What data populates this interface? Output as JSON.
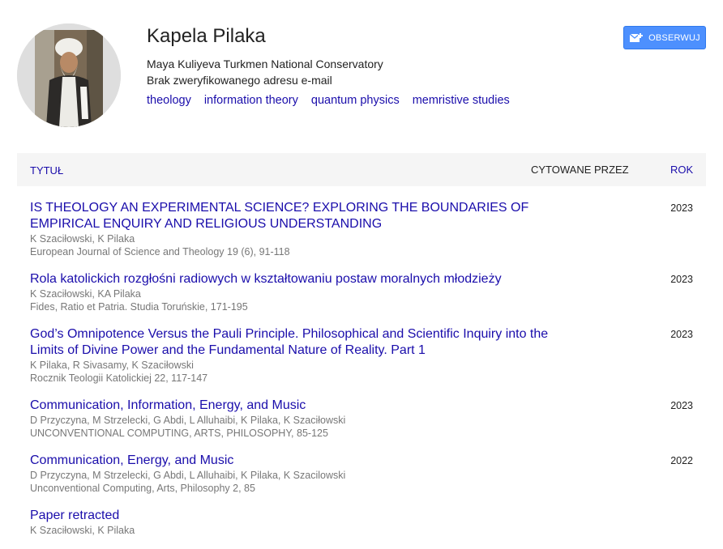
{
  "profile": {
    "name": "Kapela Pilaka",
    "affiliation": "Maya Kuliyeva Turkmen National Conservatory",
    "email_status": "Brak zweryfikowanego adresu e-mail",
    "interests": [
      "theology",
      "information theory",
      "quantum physics",
      "memristive studies"
    ],
    "follow_label": "OBSERWUJ"
  },
  "table": {
    "col_title": "TYTUŁ",
    "col_cited": "CYTOWANE PRZEZ",
    "col_year": "ROK"
  },
  "articles": [
    {
      "title": "IS THEOLOGY AN EXPERIMENTAL SCIENCE? EXPLORING THE BOUNDARIES OF EMPIRICAL ENQUIRY AND RELIGIOUS UNDERSTANDING",
      "authors": "K Szaciłowski, K Pilaka",
      "venue": "European Journal of Science and Theology 19 (6), 91-118",
      "year": "2023"
    },
    {
      "title": "Rola katolickich rozgłośni radiowych w kształtowaniu postaw moralnych młodzieży",
      "authors": "K Szaciłowski, KA Pilaka",
      "venue": "Fides, Ratio et Patria. Studia Toruńskie, 171-195",
      "year": "2023"
    },
    {
      "title": "God’s Omnipotence Versus the Pauli Principle. Philosophical and Scientific Inquiry into the Limits of Divine Power and the Fundamental Nature of Reality. Part 1",
      "authors": "K Pilaka, R Sivasamy, K Szaciłowski",
      "venue": "Rocznik Teologii Katolickiej 22, 117-147",
      "year": "2023"
    },
    {
      "title": "Communication, Information, Energy, and Music",
      "authors": "D Przyczyna, M Strzelecki, G Abdi, L Alluhaibi, K Pilaka, K Szaciłowski",
      "venue": "UNCONVENTIONAL COMPUTING, ARTS, PHILOSOPHY, 85-125",
      "year": "2023"
    },
    {
      "title": "Communication, Energy, and Music",
      "authors": "D Przyczyna, M Strzelecki, G Abdi, L Alluhaibi, K Pilaka, K Szacilowski",
      "venue": "Unconventional Computing, Arts, Philosophy 2, 85",
      "year": "2022"
    },
    {
      "title": "Paper retracted",
      "authors": "K Szaciłowski, K Pilaka",
      "venue": "",
      "year": ""
    }
  ]
}
